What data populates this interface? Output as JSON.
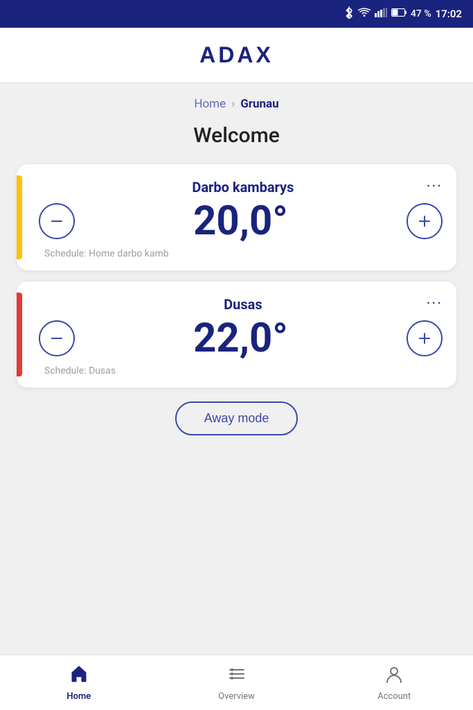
{
  "statusBar": {
    "battery": "47 %",
    "time": "17:02",
    "batteryColor": "#ffffff"
  },
  "header": {
    "logo": "ADAX"
  },
  "locationNav": {
    "homeLabel": "Home",
    "separator": "",
    "currentLocation": "Grunau"
  },
  "welcome": {
    "title": "Welcome"
  },
  "devices": [
    {
      "id": "device-1",
      "name": "Darbo kambarys",
      "temperature": "20,0°",
      "schedule": "Schedule: Home darbo kamb",
      "indicatorClass": "indicator-yellow"
    },
    {
      "id": "device-2",
      "name": "Dusas",
      "temperature": "22,0°",
      "schedule": "Schedule: Dusas",
      "indicatorClass": "indicator-orange"
    }
  ],
  "awayModeButton": {
    "label": "Away mode"
  },
  "bottomNav": {
    "items": [
      {
        "id": "home",
        "label": "Home",
        "active": true
      },
      {
        "id": "overview",
        "label": "Overview",
        "active": false
      },
      {
        "id": "account",
        "label": "Account",
        "active": false
      }
    ]
  }
}
